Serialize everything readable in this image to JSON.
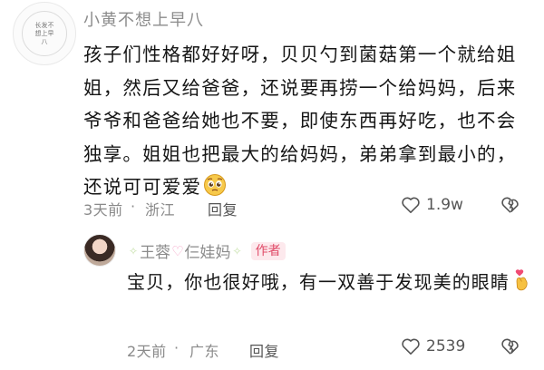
{
  "main_comment": {
    "username": "小黄不想上早八",
    "avatar_text": "长发不想上早八",
    "text": "孩子们性格都好好呀，贝贝勺到菌菇第一个就给姐姐，然后又给爸爸，还说要再捞一个给妈妈，后来爷爷和爸爸给她也不要，即使东西再好吃，也不会独享。姐姐也把最大的给妈妈，弟弟拿到最小的，还说可可爱爱",
    "emoji_icon": "pleading-face-icon",
    "time": "3天前",
    "separator": "·",
    "location": "浙江",
    "reply_label": "回复",
    "like_count": "1.9w"
  },
  "reply_comment": {
    "username_part1": "王蓉",
    "username_part2": "仨娃妈",
    "deco_glyph": "✧",
    "heart_glyph": "♡",
    "author_badge": "作者",
    "text": "宝贝，你也很好哦，有一双善于发现美的眼睛",
    "emoji_icon": "finger-heart-icon",
    "time": "2天前",
    "separator": "·",
    "location": "广东",
    "reply_label": "回复",
    "like_count": "2539"
  },
  "colors": {
    "meta_gray": "#8a8a8a",
    "author_red": "#e04b68",
    "author_bg": "#fde9ed"
  }
}
